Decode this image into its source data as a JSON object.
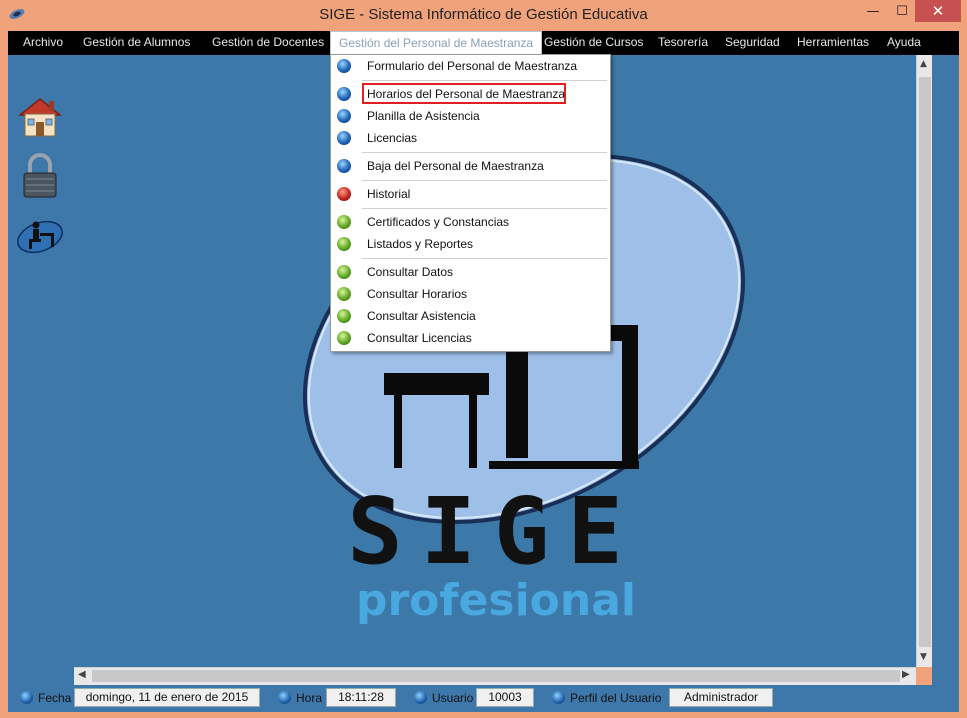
{
  "window": {
    "title": "SIGE - Sistema Informático de Gestión Educativa",
    "minimize": "—",
    "maximize": "☐",
    "close": "✕"
  },
  "menubar": {
    "items": [
      "Archivo",
      "Gestión de  Alumnos",
      "Gestión de Docentes",
      "Gestión del Personal de Maestranza",
      "Gestión de Cursos",
      "Tesorería",
      "Seguridad",
      "Herramientas",
      "Ayuda"
    ],
    "active_index": 3
  },
  "dropdown": {
    "items": [
      {
        "label": "Formulario del Personal de Maestranza",
        "dot": "blue"
      },
      {
        "label": "Horarios del Personal de Maestranza",
        "dot": "blue",
        "highlighted": true
      },
      {
        "label": "Planilla de Asistencia",
        "dot": "blue"
      },
      {
        "label": "Licencias",
        "dot": "blue"
      },
      {
        "label": "Baja del Personal de Maestranza",
        "dot": "blue"
      },
      {
        "label": "Historial",
        "dot": "red"
      },
      {
        "label": "Certificados y Constancias",
        "dot": "green"
      },
      {
        "label": "Listados y Reportes",
        "dot": "green"
      },
      {
        "label": "Consultar Datos",
        "dot": "green"
      },
      {
        "label": "Consultar Horarios",
        "dot": "green"
      },
      {
        "label": "Consultar Asistencia",
        "dot": "green"
      },
      {
        "label": "Consultar Licencias",
        "dot": "green"
      }
    ]
  },
  "left_toolbar": {
    "icons": [
      "house-icon",
      "padlock-icon",
      "desk-person-icon"
    ]
  },
  "logo": {
    "title": "SIGE",
    "subtitle": "profesional"
  },
  "statusbar": {
    "fecha_label": "Fecha",
    "fecha_value": "domingo, 11 de enero de 2015",
    "hora_label": "Hora",
    "hora_value": "18:11:28",
    "usuario_label": "Usuario",
    "usuario_value": "10003",
    "perfil_label": "Perfil del Usuario",
    "perfil_value": "Administrador"
  },
  "colors": {
    "window_frame": "#f0a27a",
    "menubar_bg": "#000000",
    "client_bg": "#3c79a8",
    "ellipse": "#9ebfe8",
    "logo_text": "#111111",
    "logo_subtitle": "#4aa8e0",
    "highlight": "#e02020"
  }
}
